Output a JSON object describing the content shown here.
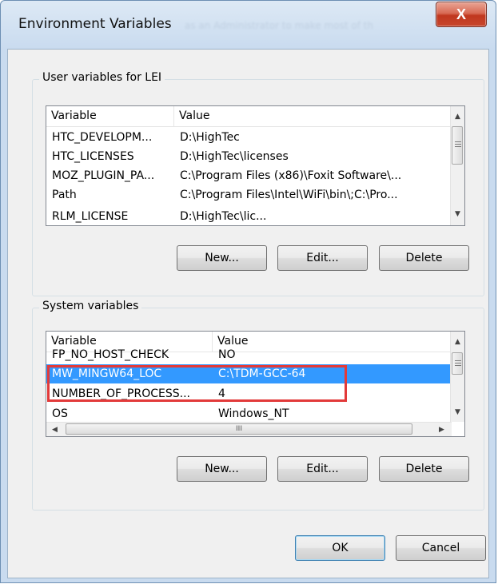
{
  "window": {
    "title": "Environment Variables",
    "background_text": "as an Administrator to make most of th",
    "close_glyph": "X"
  },
  "user_vars": {
    "group_label": "User variables for LEI",
    "columns": [
      "Variable",
      "Value"
    ],
    "rows": [
      {
        "variable": "HTC_DEVELOPM...",
        "value": "D:\\HighTec"
      },
      {
        "variable": "HTC_LICENSES",
        "value": "D:\\HighTec\\licenses"
      },
      {
        "variable": "MOZ_PLUGIN_PA...",
        "value": "C:\\Program Files (x86)\\Foxit Software\\..."
      },
      {
        "variable": "Path",
        "value": "C:\\Program Files\\Intel\\WiFi\\bin\\;C:\\Pro..."
      },
      {
        "variable": "RLM_LICENSE",
        "value": "D:\\HighTec\\lic..."
      }
    ],
    "buttons": {
      "new": "New...",
      "edit": "Edit...",
      "delete": "Delete"
    }
  },
  "system_vars": {
    "group_label": "System variables",
    "columns": [
      "Variable",
      "Value"
    ],
    "rows": [
      {
        "variable": "FP_NO_HOST_CHECK",
        "value": "NO"
      },
      {
        "variable": "MW_MINGW64_LOC",
        "value": "C:\\TDM-GCC-64",
        "selected": true
      },
      {
        "variable": "NUMBER_OF_PROCESS...",
        "value": "4"
      },
      {
        "variable": "OS",
        "value": "Windows_NT"
      }
    ],
    "hscroll_grip": "III",
    "buttons": {
      "new": "New...",
      "edit": "Edit...",
      "delete": "Delete"
    }
  },
  "dialog_buttons": {
    "ok": "OK",
    "cancel": "Cancel"
  },
  "colors": {
    "selection": "#3399ff",
    "highlight_box": "#e23a3a",
    "close_button": "#c7462c"
  },
  "icons": {
    "scroll_up": "▲",
    "scroll_down": "▼",
    "scroll_left": "◀",
    "scroll_right": "▶"
  }
}
